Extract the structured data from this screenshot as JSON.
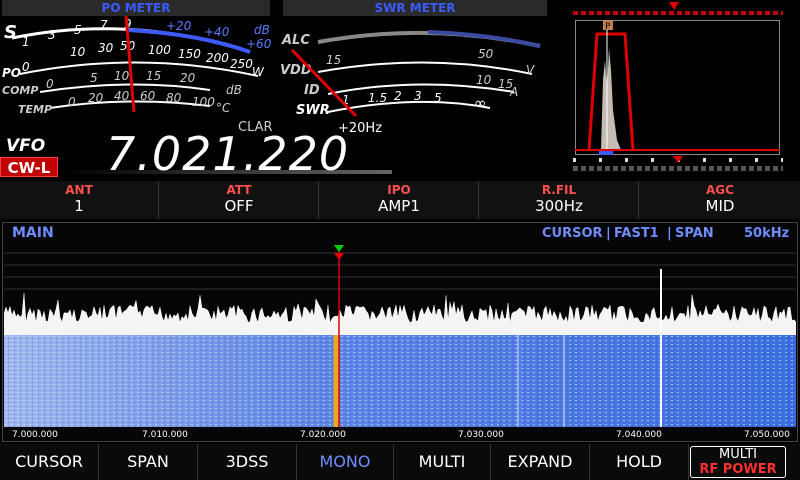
{
  "po_meter": {
    "title": "PO METER",
    "s_label": "S",
    "po_label": "PO",
    "comp_label": "COMP",
    "temp_label": "TEMP",
    "s_scale": [
      "1",
      "3",
      "5",
      "7",
      "9",
      "+20",
      "+40",
      "+60"
    ],
    "s_unit": "dB",
    "po_scale": [
      "0",
      "10",
      "50",
      "100",
      "150",
      "200",
      "250"
    ],
    "po_unit": "W",
    "comp_scale": [
      "0",
      "5",
      "10",
      "15",
      "20"
    ],
    "comp_unit": "dB",
    "temp_scale": [
      "0",
      "20",
      "40",
      "60",
      "80",
      "100"
    ],
    "temp_unit": "°C",
    "scale_small": [
      "10",
      "30",
      "50",
      "100",
      "150",
      "200",
      "250"
    ]
  },
  "swr_meter": {
    "title": "SWR METER",
    "alc_label": "ALC",
    "vdd_label": "VDD",
    "id_label": "ID",
    "swr_label": "SWR",
    "vdd_scale": [
      "15",
      "50"
    ],
    "vdd_unit": "V",
    "id_scale": [
      "10",
      "15"
    ],
    "id_unit": "A",
    "swr_scale": [
      "1",
      "1.5",
      "2",
      "3",
      "5",
      "∞"
    ]
  },
  "vfo": {
    "label": "VFO",
    "mode": "CW-L",
    "clar_label": "CLAR",
    "clar_value": "+20Hz",
    "frequency": "7.021.220"
  },
  "filter_scope": {
    "marker": "P"
  },
  "status": [
    {
      "label": "ANT",
      "value": "1"
    },
    {
      "label": "ATT",
      "value": "OFF"
    },
    {
      "label": "IPO",
      "value": "AMP1"
    },
    {
      "label": "R.FIL",
      "value": "300Hz"
    },
    {
      "label": "AGC",
      "value": "MID"
    }
  ],
  "scope": {
    "title": "MAIN",
    "opt1": "CURSOR",
    "opt2": "FAST1",
    "opt3": "SPAN",
    "span_value": "50kHz",
    "freq_labels": [
      "7.000.000",
      "7.010.000",
      "7.020.000",
      "7.030.000",
      "7.040.000",
      "7.050.000"
    ]
  },
  "buttons": [
    {
      "label": "CURSOR"
    },
    {
      "label": "SPAN"
    },
    {
      "label": "3DSS"
    },
    {
      "label": "MONO"
    },
    {
      "label": "MULTI"
    },
    {
      "label": "EXPAND"
    },
    {
      "label": "HOLD"
    }
  ],
  "multi_button": {
    "line1": "MULTI",
    "line2": "RF POWER"
  },
  "colors": {
    "accent": "#6f8dff",
    "mode": "#c00000",
    "needle": "#e00000",
    "waterfall": "#3a6ee0"
  }
}
